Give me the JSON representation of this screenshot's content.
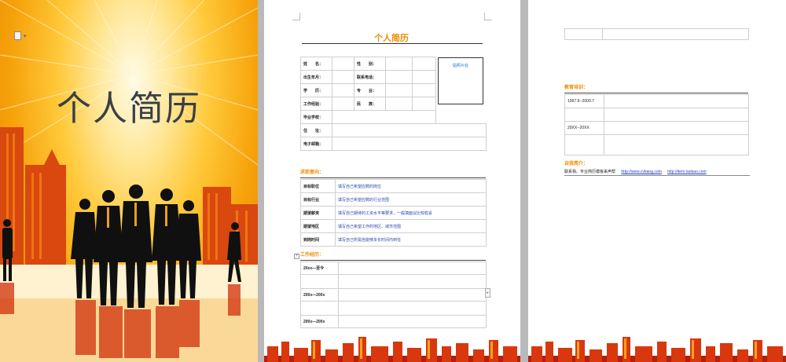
{
  "cover": {
    "title": "个人简历",
    "colors": {
      "bright": "#fff6cc",
      "mid": "#ffc93a",
      "deep": "#e27a05",
      "silhouette": "#111111"
    }
  },
  "resume": {
    "title": "个人简历",
    "photo_label": "贴照片处",
    "basic": [
      [
        "姓　　名：",
        "",
        "性　　别：",
        "",
        ""
      ],
      [
        "出生年月：",
        "",
        "联系电话：",
        "",
        ""
      ],
      [
        "学　　历：",
        "",
        "专　　业：",
        "",
        ""
      ],
      [
        "工作经验：",
        "",
        "民　　族：",
        "",
        ""
      ],
      [
        "毕业学校：",
        ""
      ],
      [
        "住　　址：",
        ""
      ],
      [
        "电子邮箱：",
        ""
      ]
    ],
    "intent_heading": "求职意向：",
    "intent": [
      {
        "label": "目标职位",
        "value": "填写自己希望应聘的岗位"
      },
      {
        "label": "目标行业",
        "value": "填写自己希望应聘的行业范围"
      },
      {
        "label": "期望薪资",
        "value": "填写自己期待的工资水平等要求，一般填面议比较稳妥"
      },
      {
        "label": "期望地区",
        "value": "填写自己希望工作的地区、城市范围"
      },
      {
        "label": "到岗时间",
        "value": "填写自己所需自能够多长时间内到任"
      }
    ],
    "work_heading": "工作经历：",
    "work": [
      {
        "label": "20xx—至今"
      },
      {
        "label": "200x—200x"
      },
      {
        "label": "200x—200x"
      }
    ],
    "education_heading": "教育培训：",
    "education": [
      {
        "label": "1997.9--2000.7"
      },
      {
        "label": "20XX--20XX"
      }
    ],
    "self_heading": "自我简介：",
    "contact": {
      "text": "联系我。专业简历模板来声帮",
      "link1": "http://www.cvbang.com",
      "link2": "http://item.taobao.com"
    }
  }
}
